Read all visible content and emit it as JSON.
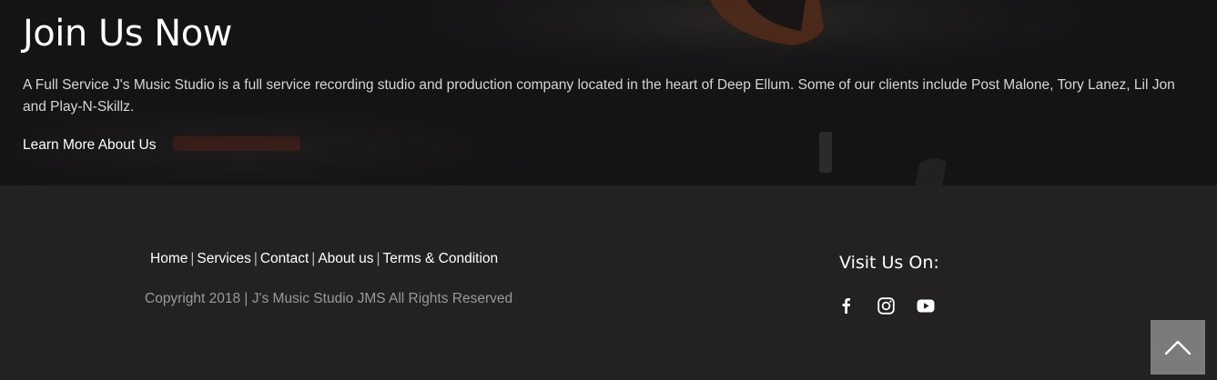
{
  "hero": {
    "title": "Join Us Now",
    "description": "A Full Service J's Music Studio is a full service recording studio and production company located in the heart of Deep Ellum. Some of our clients include Post Malone, Tory Lanez, Lil Jon and Play-N-Skillz.",
    "link_label": "Learn More About Us"
  },
  "footer": {
    "nav": [
      {
        "label": "Home"
      },
      {
        "label": "Services"
      },
      {
        "label": "Contact"
      },
      {
        "label": "About us"
      },
      {
        "label": "Terms & Condition"
      }
    ],
    "separator": "|",
    "copyright": "Copyright 2018 | J's Music Studio JMS All Rights Reserved",
    "visit_heading": "Visit Us On:",
    "social": [
      {
        "icon": "facebook-icon"
      },
      {
        "icon": "instagram-icon"
      },
      {
        "icon": "youtube-icon"
      }
    ]
  },
  "back_to_top": {
    "icon": "chevron-up-icon"
  },
  "colors": {
    "footer_bg": "#232122",
    "hero_bg": "#1d1c1e",
    "back_to_top_bg": "#7c7b7c",
    "muted_text": "#9a9a9a"
  }
}
